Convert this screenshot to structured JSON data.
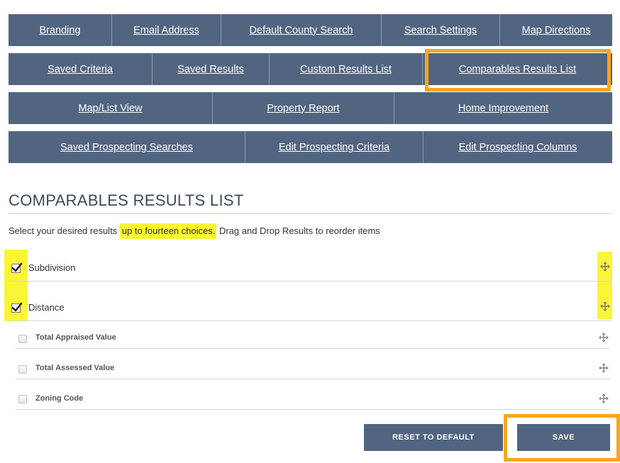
{
  "nav": {
    "row1": [
      "Branding",
      "Email Address",
      "Default County Search",
      "Search Settings",
      "Map Directions"
    ],
    "row2": [
      "Saved Criteria",
      "Saved Results",
      "Custom Results List",
      "Comparables Results List"
    ],
    "row3": [
      "Map/List View",
      "Property Report",
      "Home Improvement"
    ],
    "row4": [
      "Saved Prospecting Searches",
      "Edit Prospecting Criteria",
      "Edit Prospecting Columns"
    ]
  },
  "page_title": "COMPARABLES RESULTS LIST",
  "instructions": {
    "before": "Select your desired results ",
    "highlight": "up to fourteen choices.",
    "after": " Drag and Drop Results to reorder items"
  },
  "items": [
    {
      "label": "Subdivision",
      "checked": true
    },
    {
      "label": "Distance",
      "checked": true
    },
    {
      "label": "Total Appraised Value",
      "checked": false
    },
    {
      "label": "Total Assessed Value",
      "checked": false
    },
    {
      "label": "Zoning Code",
      "checked": false
    }
  ],
  "buttons": {
    "reset": "RESET TO DEFAULT",
    "save": "SAVE"
  },
  "colors": {
    "tab_bg": "#526580",
    "orange_highlight": "#f5a623",
    "yellow_highlight": "#fbf536"
  }
}
